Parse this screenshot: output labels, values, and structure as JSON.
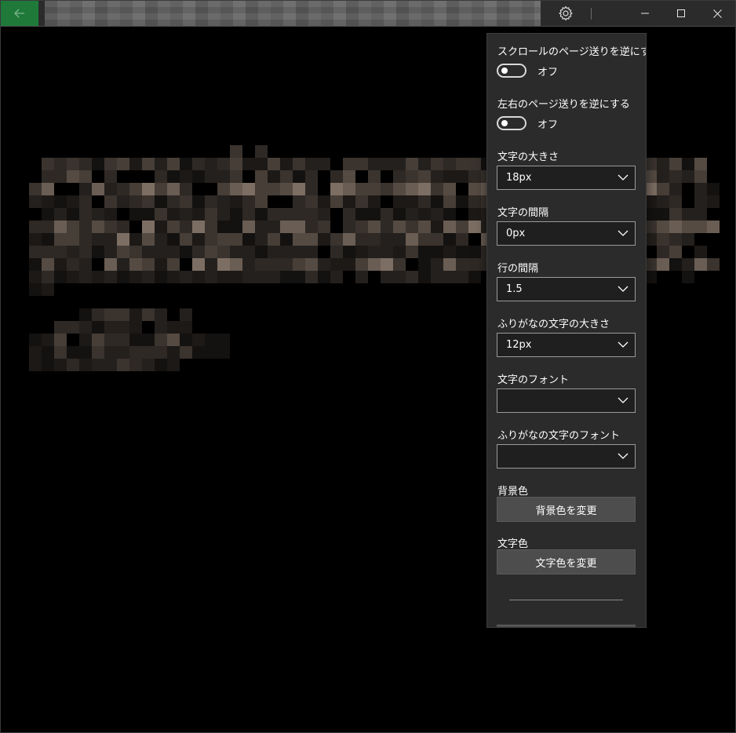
{
  "titlebar": {
    "back_icon": "arrow-left-icon",
    "settings_icon": "gear-icon",
    "minimize_icon": "minimize-icon",
    "maximize_icon": "maximize-icon",
    "close_icon": "close-icon"
  },
  "settings": {
    "reverse_scroll": {
      "label": "スクロールのページ送りを逆にする",
      "state": "オフ"
    },
    "reverse_lr": {
      "label": "左右のページ送りを逆にする",
      "state": "オフ"
    },
    "font_size": {
      "label": "文字の大きさ",
      "value": "18px"
    },
    "letter_spacing": {
      "label": "文字の間隔",
      "value": "0px"
    },
    "line_spacing": {
      "label": "行の間隔",
      "value": "1.5"
    },
    "ruby_size": {
      "label": "ふりがなの文字の大きさ",
      "value": "12px"
    },
    "font": {
      "label": "文字のフォント",
      "value": ""
    },
    "ruby_font": {
      "label": "ふりがなの文字のフォント",
      "value": ""
    },
    "bg_color": {
      "label": "背景色",
      "button": "背景色を変更"
    },
    "text_color": {
      "label": "文字色",
      "button": "文字色を変更"
    }
  },
  "colors": {
    "accent_back": "#1f7a3a",
    "background": "#000000",
    "flyout": "#2b2b2b"
  }
}
